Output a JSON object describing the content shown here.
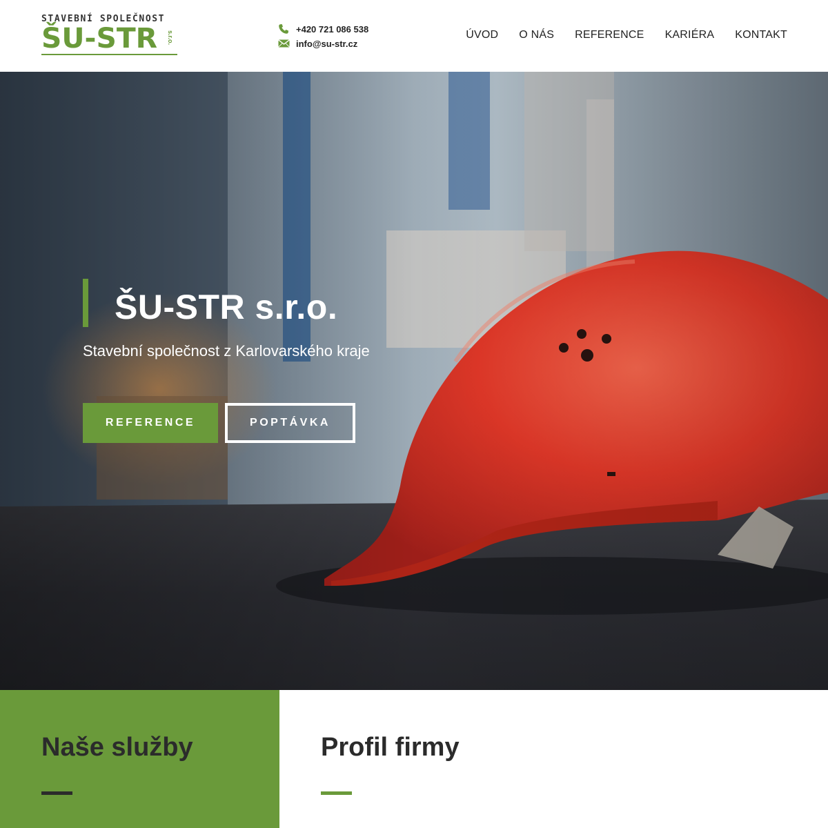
{
  "brand": {
    "tagline": "STAVEBNÍ SPOLEČNOST",
    "name": "ŠU-STR",
    "suffix": "s.r.o.",
    "color_primary": "#6a9a3a"
  },
  "contact": {
    "phone": "+420 721 086 538",
    "email": "info@su-str.cz",
    "phone_icon": "phone-icon",
    "email_icon": "envelope-icon"
  },
  "nav": {
    "items": [
      "ÚVOD",
      "O NÁS",
      "REFERENCE",
      "KARIÉRA",
      "KONTAKT"
    ]
  },
  "hero": {
    "title": "ŠU-STR s.r.o.",
    "subtitle": "Stavební společnost z Karlovarského kraje",
    "button_primary": "REFERENCE",
    "button_secondary": "POPTÁVKA"
  },
  "sections": {
    "services_title": "Naše služby",
    "profile_title": "Profil firmy"
  }
}
